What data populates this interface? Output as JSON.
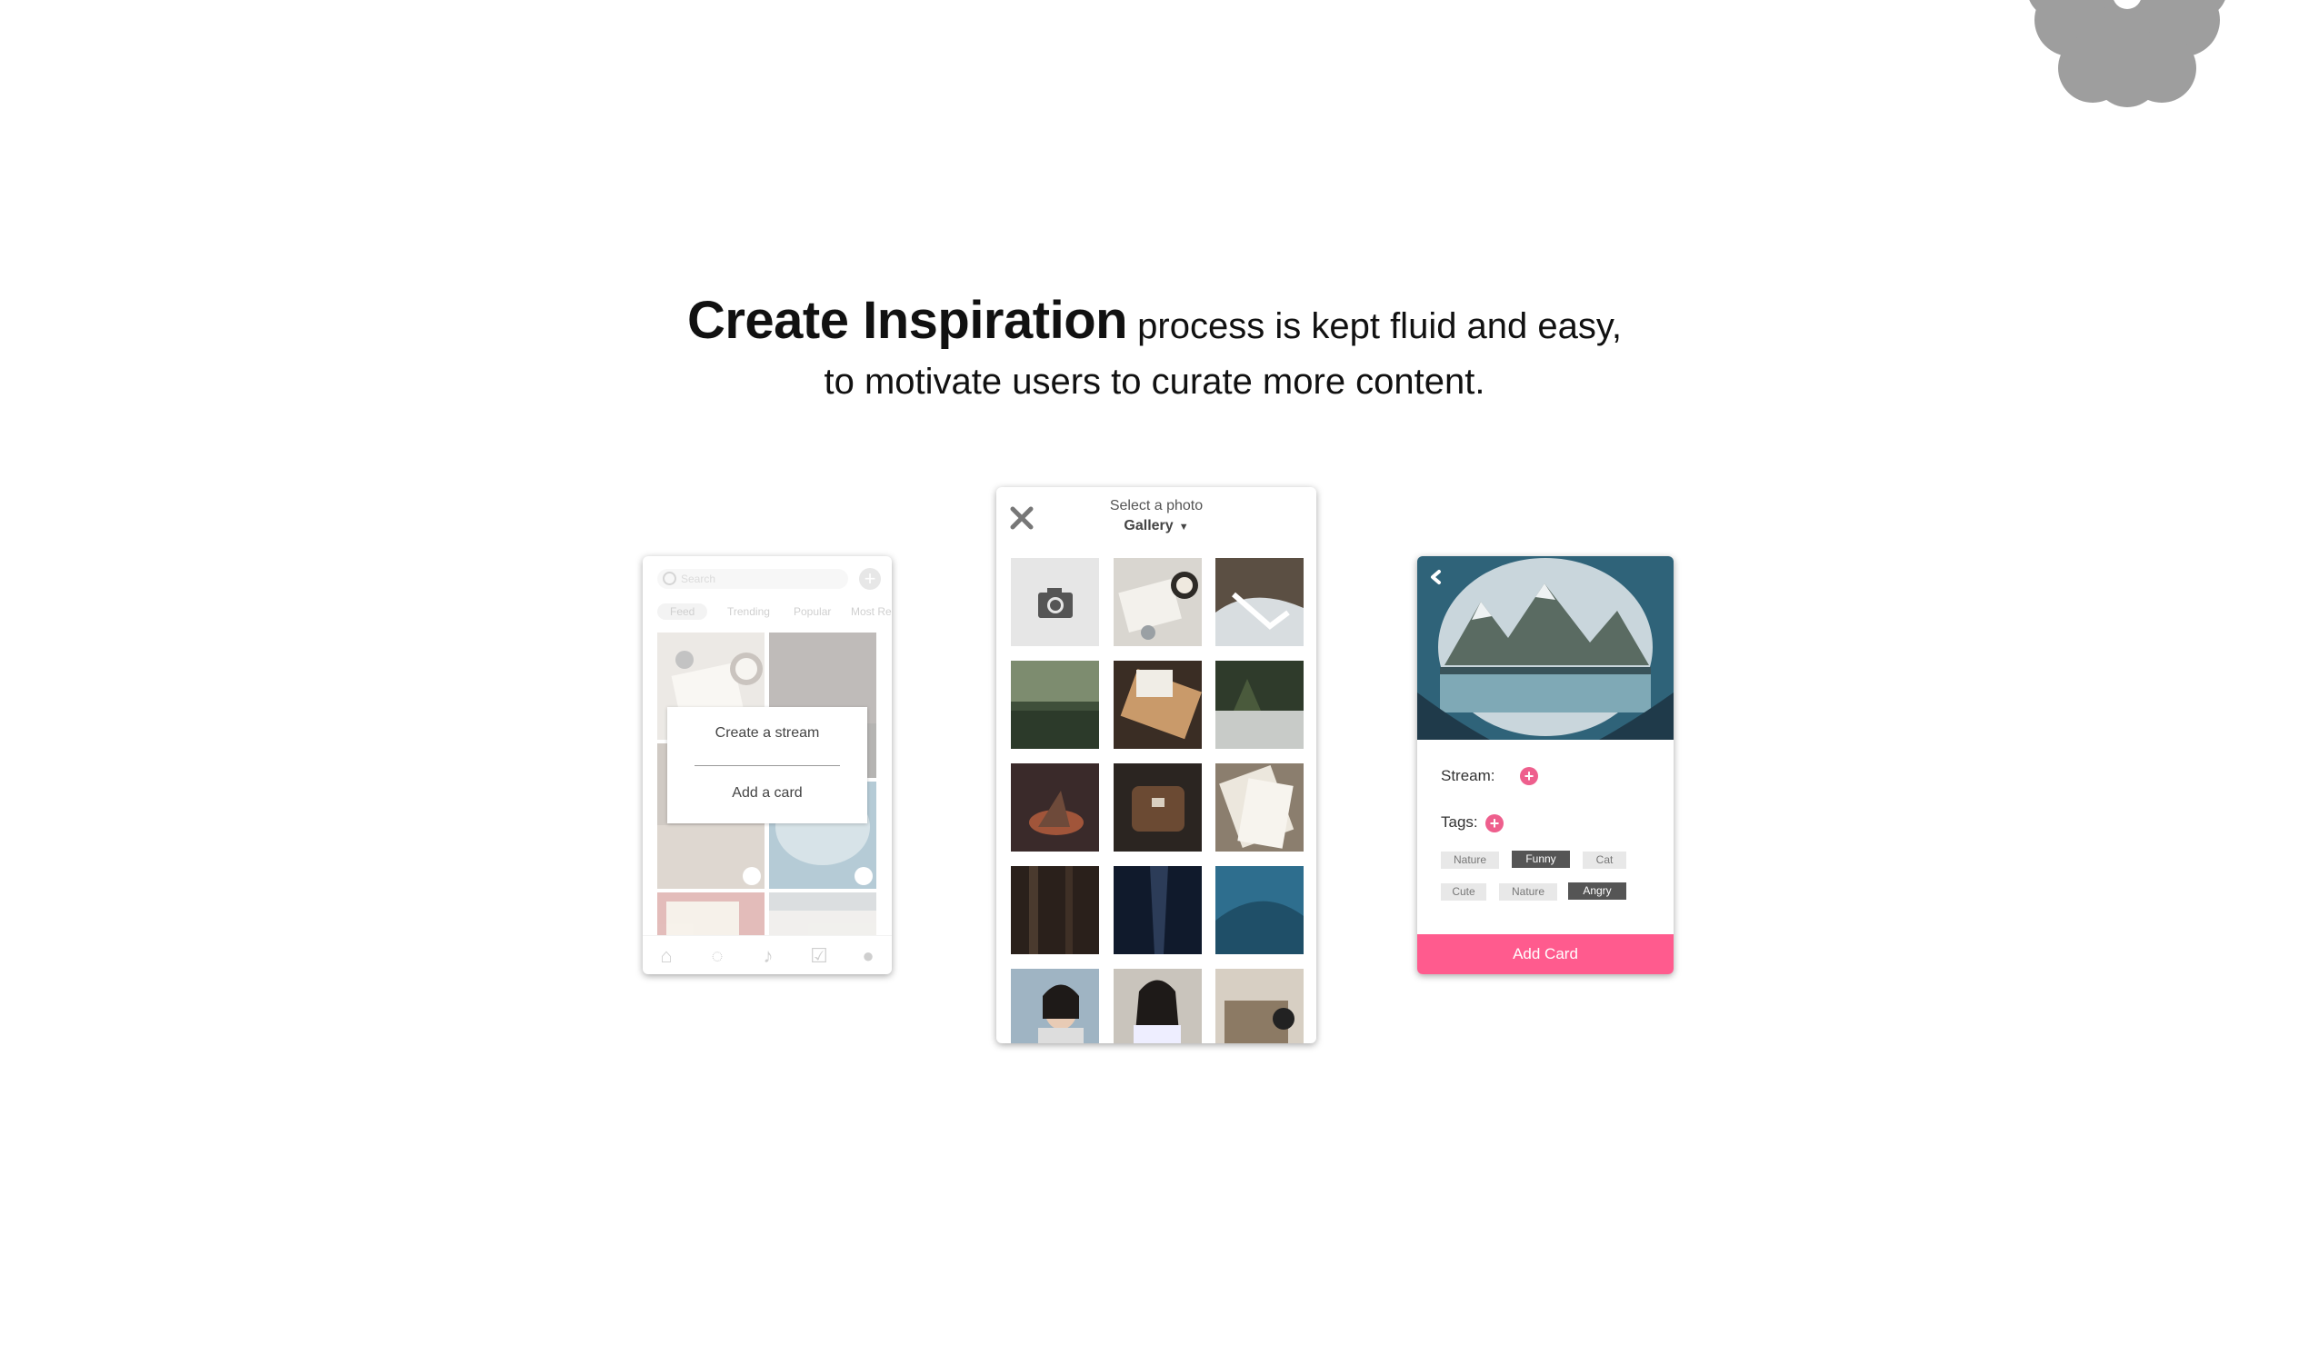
{
  "headline": {
    "bold": "Create Inspiration",
    "line1_rest": " process is kept fluid and easy,",
    "line2": "to motivate users to curate more content."
  },
  "phone_feed": {
    "search_placeholder": "Search",
    "tabs": [
      "Feed",
      "Trending",
      "Popular",
      "Most Re"
    ],
    "menu": {
      "create_stream": "Create a stream",
      "add_card": "Add a card"
    },
    "nav_icons": [
      "home-icon",
      "chat-icon",
      "bell-icon",
      "check-icon",
      "profile-icon"
    ]
  },
  "phone_select": {
    "title": "Select a photo",
    "source": "Gallery",
    "source_arrow": "▼"
  },
  "phone_card": {
    "stream_label": "Stream:",
    "tags_label": "Tags:",
    "tags": [
      {
        "label": "Nature",
        "selected": false
      },
      {
        "label": "Funny",
        "selected": true
      },
      {
        "label": "Cat",
        "selected": false
      },
      {
        "label": "Cute",
        "selected": false
      },
      {
        "label": "Nature",
        "selected": false
      },
      {
        "label": "Angry",
        "selected": true
      }
    ],
    "button": "Add Card"
  },
  "colors": {
    "accent": "#ff5b8e",
    "add_icon": "#ee5f8d",
    "tag_selected": "#555555",
    "tag_default": "#e8e8e8",
    "flower": "#9e9e9e"
  }
}
